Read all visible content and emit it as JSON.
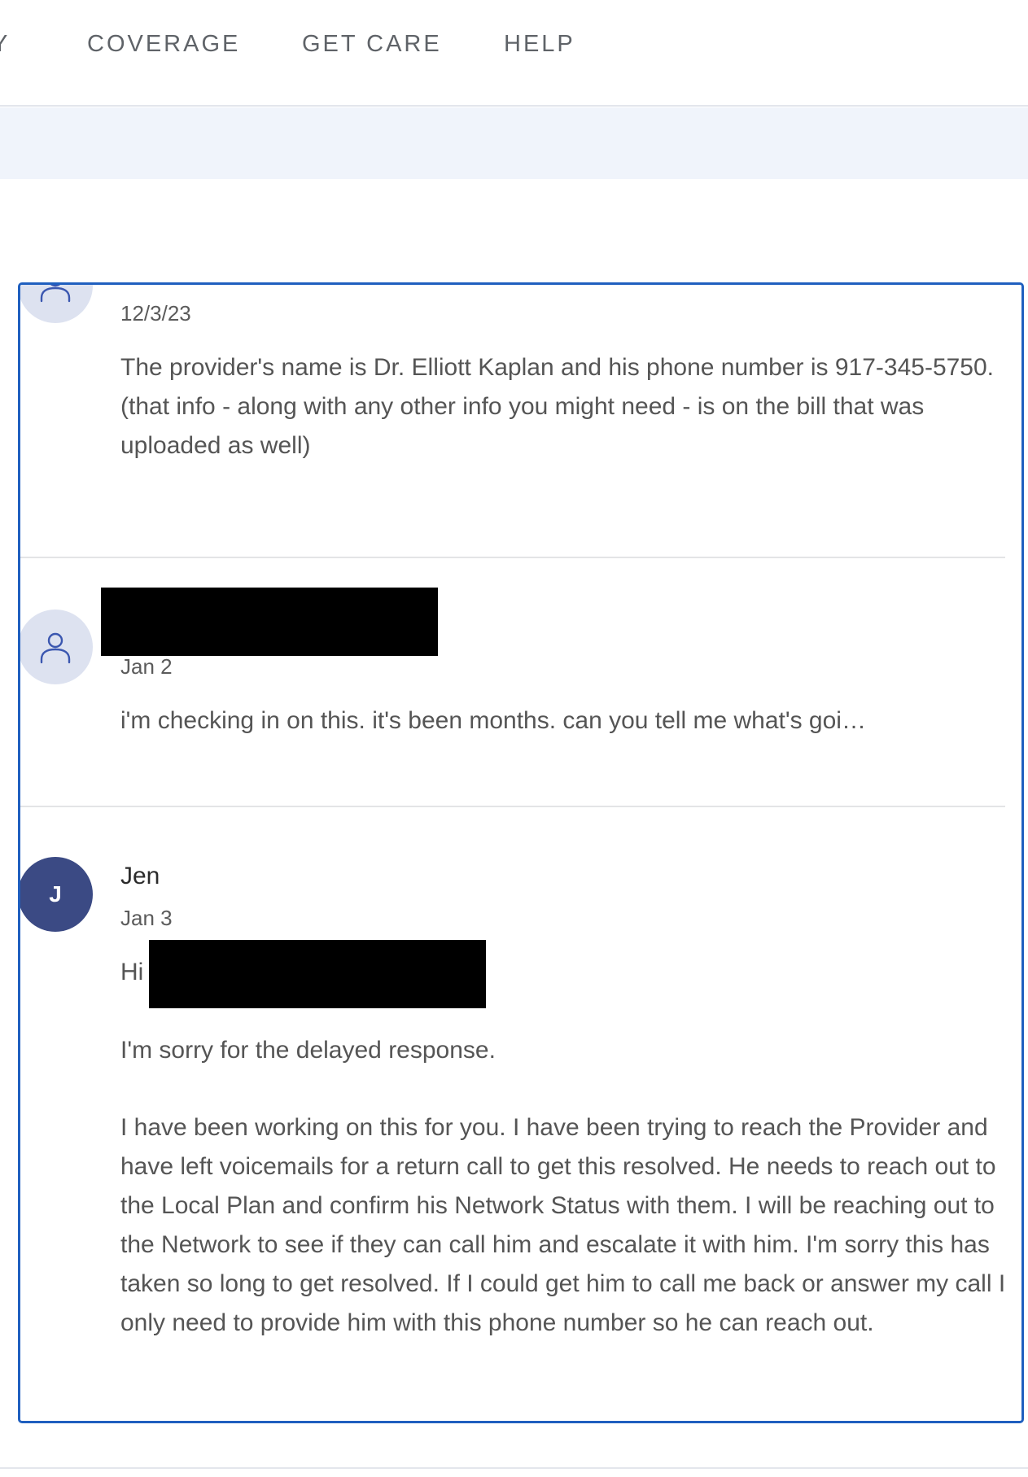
{
  "nav": {
    "partial_label": "Y",
    "coverage": "COVERAGE",
    "get_care": "GET CARE",
    "help": "HELP"
  },
  "messages": [
    {
      "date": "12/3/23",
      "body": "The provider's name is Dr. Elliott Kaplan and his phone number is 917-345-5750. (that info - along with any other info you might need - is on the bill that was uploaded as well)",
      "avatar_icon": "person-icon"
    },
    {
      "sender_redacted": true,
      "date": "Jan 2",
      "body": "i'm checking in on this. it's been months. can you tell me what's goi…",
      "avatar_icon": "person-icon"
    },
    {
      "sender": "Jen",
      "avatar_initial": "J",
      "date": "Jan 3",
      "greeting": "Hi",
      "paragraph1": "I'm sorry for the delayed response.",
      "paragraph2": "I have been working on this for you. I have been trying to reach the Provider and have left voicemails for a return call to get this resolved. He needs to reach out to the Local Plan and confirm his Network Status with them. I will be reaching out to the Network to see if they can call him and escalate it with him. I'm sorry this has taken so long to get resolved. If I could get him to call me back or answer my call I only need to provide him with this phone number so he can reach out."
    }
  ],
  "colors": {
    "panel_border": "#1f5fbf",
    "avatar_light": "#dde2f0",
    "avatar_dark": "#3b4a84",
    "subbar": "#f0f4fb",
    "redaction": "#000000"
  }
}
